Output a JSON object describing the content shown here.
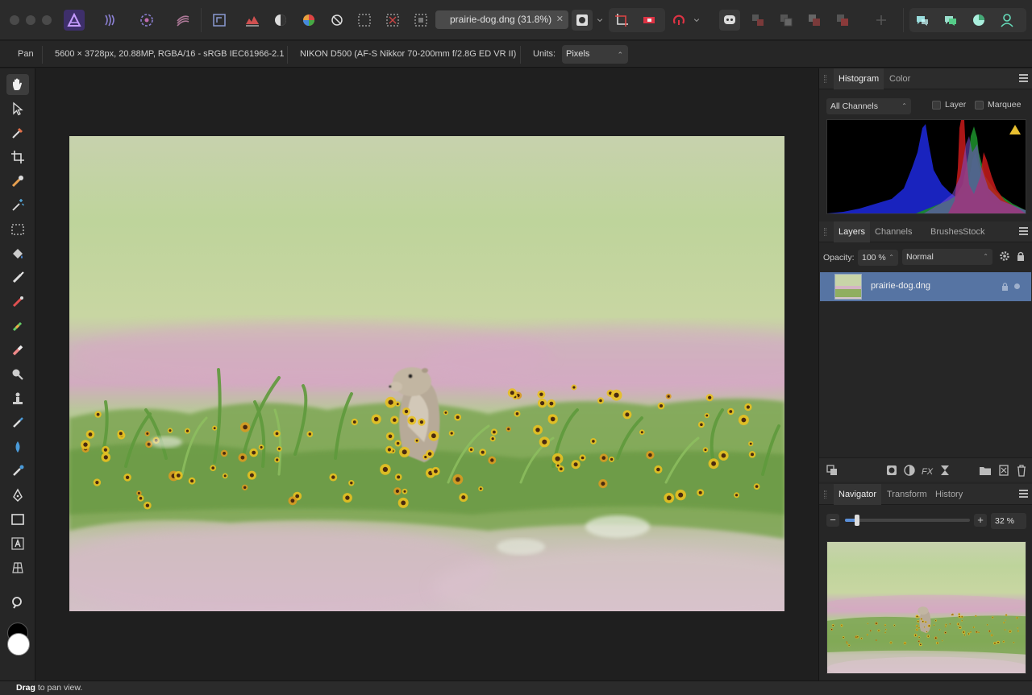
{
  "document": {
    "tab_title": "prairie-dog.dng (31.8%)"
  },
  "context_toolbar": {
    "tool_name": "Pan",
    "image_info": "5600 × 3728px, 20.88MP, RGBA/16 - sRGB IEC61966-2.1",
    "camera_info": "NIKON D500 (AF-S Nikkor 70-200mm f/2.8G ED VR II)",
    "units_label": "Units:",
    "units_value": "Pixels"
  },
  "histogram_panel": {
    "tabs": [
      "Histogram",
      "Color"
    ],
    "channels_value": "All Channels",
    "layer_checkbox_label": "Layer",
    "marquee_checkbox_label": "Marquee",
    "warning_icon": "warning-icon"
  },
  "layers_panel": {
    "tabs": [
      "Layers",
      "Channels",
      "Brushes",
      "Stock"
    ],
    "opacity_label": "Opacity:",
    "opacity_value": "100 %",
    "blend_mode": "Normal",
    "layers": [
      {
        "name": "prairie-dog.dng",
        "selected": true
      }
    ]
  },
  "navigator_panel": {
    "tabs": [
      "Navigator",
      "Transform",
      "History"
    ],
    "zoom_value": "32 %",
    "zoom_fraction": 0.32
  },
  "status_bar": {
    "bold": "Drag",
    "text": " to pan view."
  },
  "colors": {
    "accent_selected_layer": "#5674a3",
    "app_background": "#1e1e1e",
    "primary_color": "#000000",
    "secondary_color": "#ffffff"
  }
}
